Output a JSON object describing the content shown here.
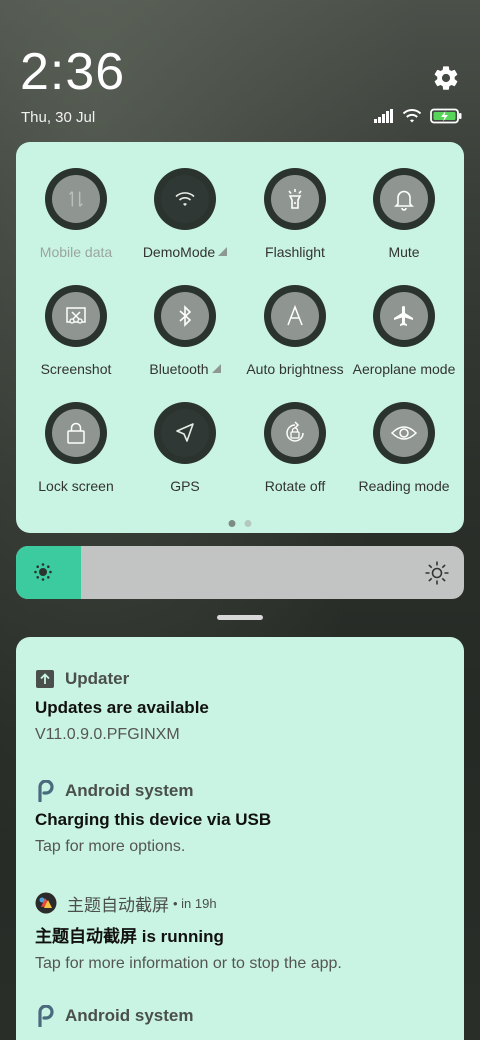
{
  "status": {
    "time": "2:36",
    "date": "Thu, 30 Jul",
    "icons": [
      "signal-icon",
      "wifi-icon",
      "battery-charging-icon"
    ]
  },
  "quick_settings": {
    "tiles": [
      {
        "label": "Mobile data",
        "icon": "mobile-data-icon",
        "state": "unavailable"
      },
      {
        "label": "DemoMode",
        "icon": "wifi-icon",
        "state": "on",
        "expandable": true
      },
      {
        "label": "Flashlight",
        "icon": "flashlight-icon",
        "state": "off"
      },
      {
        "label": "Mute",
        "icon": "bell-icon",
        "state": "off"
      },
      {
        "label": "Screenshot",
        "icon": "screenshot-icon",
        "state": "off"
      },
      {
        "label": "Bluetooth",
        "icon": "bluetooth-icon",
        "state": "off",
        "expandable": true
      },
      {
        "label": "Auto brightness",
        "icon": "auto-brightness-icon",
        "state": "off"
      },
      {
        "label": "Aeroplane mode",
        "icon": "aeroplane-icon",
        "state": "off"
      },
      {
        "label": "Lock screen",
        "icon": "lock-icon",
        "state": "off"
      },
      {
        "label": "GPS",
        "icon": "location-arrow-icon",
        "state": "on"
      },
      {
        "label": "Rotate off",
        "icon": "rotation-lock-icon",
        "state": "off"
      },
      {
        "label": "Reading mode",
        "icon": "eye-icon",
        "state": "off"
      }
    ],
    "page_count": 2,
    "current_page": 1
  },
  "brightness": {
    "level": 0.145
  },
  "notifications": [
    {
      "app": "Updater",
      "icon": "upload-arrow-icon",
      "time": "",
      "title": "Updates are available",
      "text": "V11.0.9.0.PFGINXM"
    },
    {
      "app": "Android system",
      "icon": "android-p-icon",
      "time": "",
      "title": "Charging this device via USB",
      "text": "Tap for more options."
    },
    {
      "app": "主题自动截屏",
      "icon": "app-theme-icon",
      "time": "• in 19h",
      "title": "主题自动截屏 is running",
      "text": "Tap for more information or to stop the app."
    },
    {
      "app": "Android system",
      "icon": "android-p-icon",
      "time": "",
      "title": "",
      "text": ""
    }
  ],
  "colors": {
    "panel": "#c9f4e3",
    "accent": "#3bcb9f",
    "tile_ring": "#2b332f",
    "tile_inner": "#8f9692"
  }
}
